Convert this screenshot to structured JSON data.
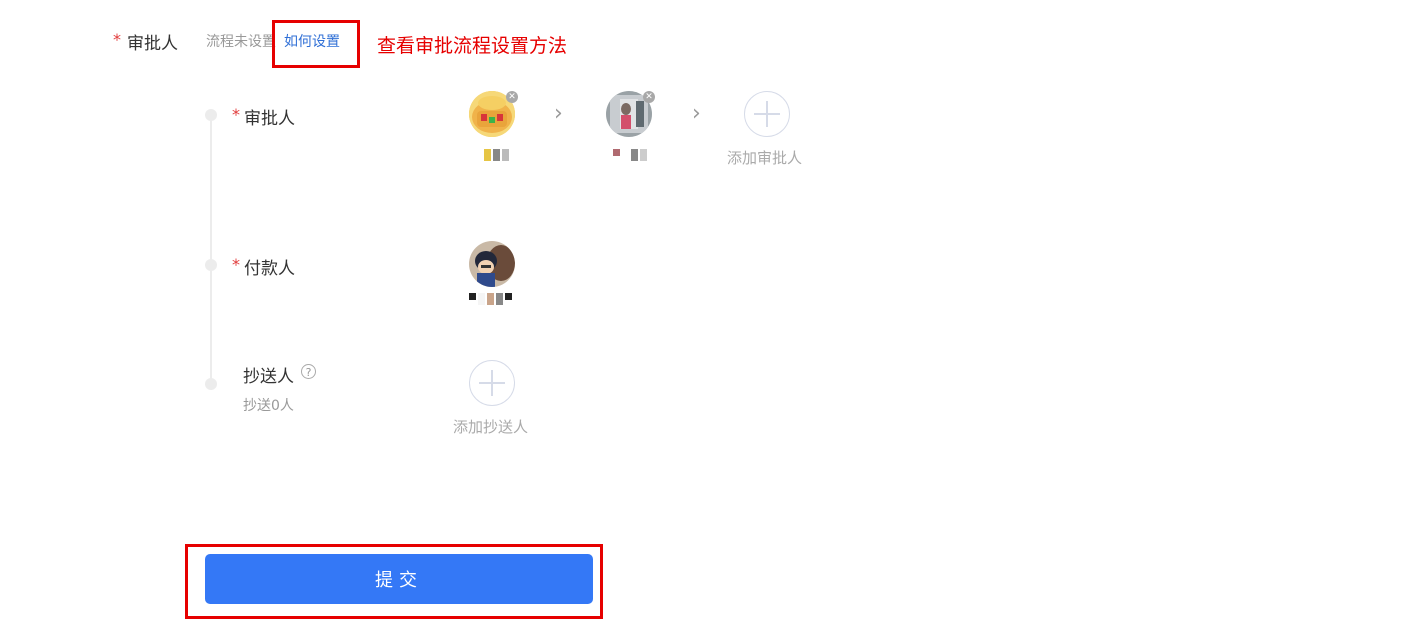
{
  "header": {
    "required_star": "*",
    "label": "审批人",
    "not_set_text": "流程未设置",
    "how_link": "如何设置",
    "annotation": "查看审批流程设置方法"
  },
  "rows": {
    "approver": {
      "star": "*",
      "label": "审批人",
      "add_label": "添加审批人",
      "separator": "›"
    },
    "payer": {
      "star": "*",
      "label": "付款人"
    },
    "cc": {
      "label": "抄送人",
      "help": "?",
      "sub": "抄送0人",
      "add_label": "添加抄送人"
    }
  },
  "submit": {
    "label": "提交"
  },
  "colors": {
    "accent": "#3478f6",
    "link": "#2f6fd6",
    "annotation_red": "#e60000",
    "required": "#e23b3b"
  },
  "icons": {
    "remove": "close-icon",
    "add": "plus-icon",
    "chevron": "chevron-right-icon",
    "help": "question-circle-icon"
  }
}
